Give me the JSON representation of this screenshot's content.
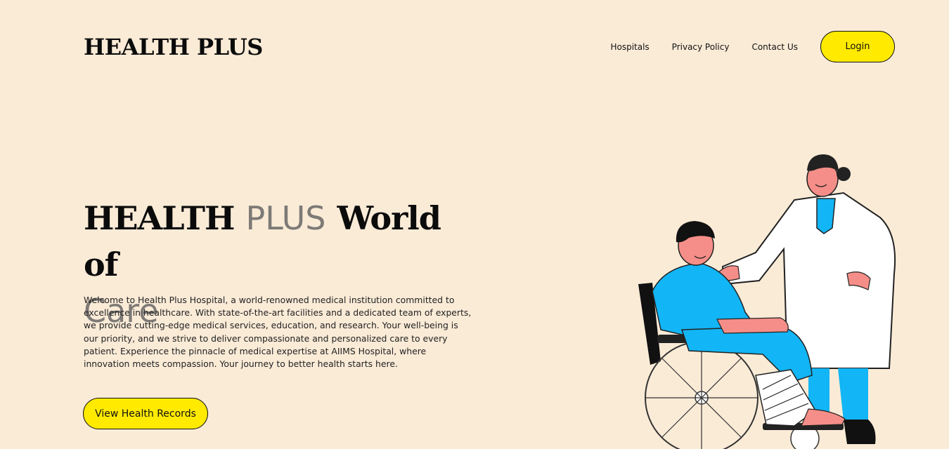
{
  "header": {
    "brand": "HEALTH PLUS",
    "nav": [
      "Hospitals",
      "Privacy Policy",
      "Contact Us"
    ],
    "login_label": "Login"
  },
  "hero": {
    "title_part1": "HEALTH",
    "title_part2": "PLUS",
    "title_part3": "World of",
    "title_part4": "Care",
    "description": "Welcome to Health Plus Hospital, a world-renowned medical institution committed to excellence in healthcare. With state-of-the-art facilities and a dedicated team of experts, we provide cutting-edge medical services, education, and research. Your well-being is our priority, and we strive to deliver compassionate and personalized care to every patient. Experience the pinnacle of medical expertise at AIIMS Hospital, where innovation meets compassion. Your journey to better health starts here.",
    "cta_label": "View Health Records"
  },
  "colors": {
    "background": "#FAEBD7",
    "accent": "#FFEA00",
    "grey_text": "#7d7a76",
    "illustration_blue": "#12B5F5",
    "skin": "#F58E88"
  },
  "illustration": {
    "icon": "doctor-with-patient-in-wheelchair-illustration"
  }
}
